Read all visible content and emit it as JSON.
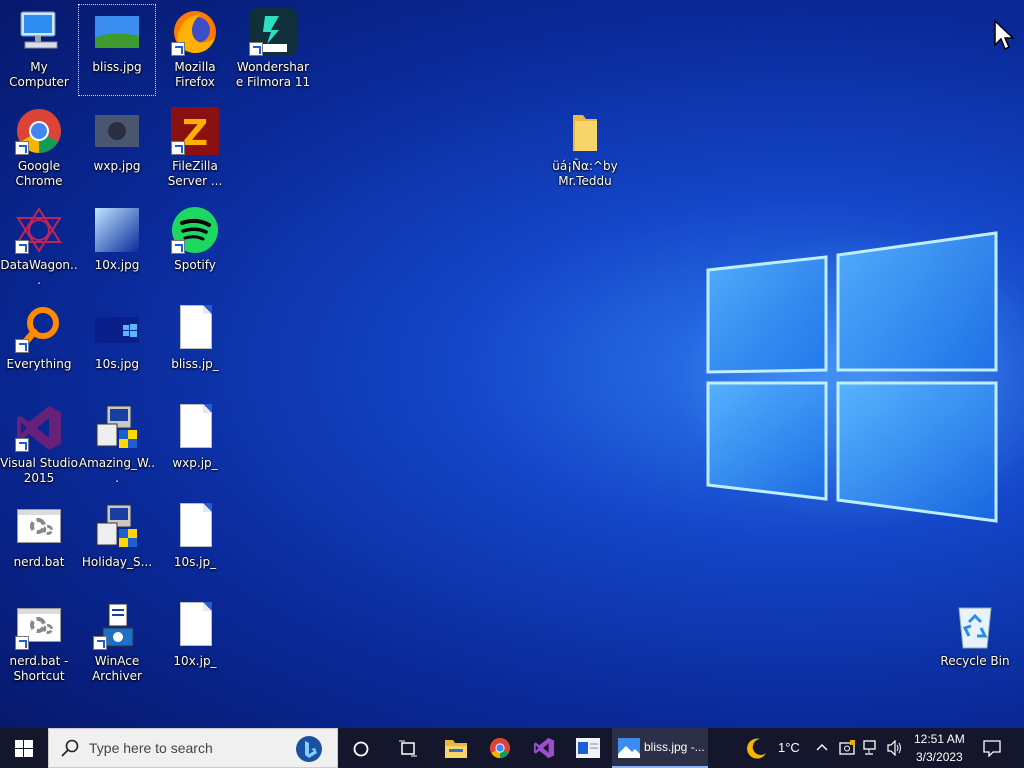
{
  "desktop": {
    "icons": [
      {
        "name": "my-computer",
        "label": "My Computer"
      },
      {
        "name": "bliss-jpg",
        "label": "bliss.jpg"
      },
      {
        "name": "mozilla-firefox",
        "label": "Mozilla Firefox"
      },
      {
        "name": "wondershare-filmora",
        "label": "Wondershare Filmora 11"
      },
      {
        "name": "google-chrome",
        "label": "Google Chrome"
      },
      {
        "name": "wxp-jpg",
        "label": "wxp.jpg"
      },
      {
        "name": "filezilla-server",
        "label": "FileZilla Server ..."
      },
      {
        "name": "folder-mr-teddu",
        "label": "üá¡Ñα:^by Mr.Teddu"
      },
      {
        "name": "datawagon",
        "label": "DataWagon..."
      },
      {
        "name": "10x-jpg",
        "label": "10x.jpg"
      },
      {
        "name": "spotify",
        "label": "Spotify"
      },
      {
        "name": "everything",
        "label": "Everything"
      },
      {
        "name": "10s-jpg",
        "label": "10s.jpg"
      },
      {
        "name": "bliss-jp_",
        "label": "bliss.jp_"
      },
      {
        "name": "visual-studio-2015",
        "label": "Visual Studio 2015"
      },
      {
        "name": "amazing-w",
        "label": "Amazing_W..."
      },
      {
        "name": "wxp-jp_",
        "label": "wxp.jp_"
      },
      {
        "name": "nerd-bat",
        "label": "nerd.bat"
      },
      {
        "name": "holiday-s",
        "label": "Holiday_S..."
      },
      {
        "name": "10s-jp_",
        "label": "10s.jp_"
      },
      {
        "name": "nerd-bat-shortcut",
        "label": "nerd.bat - Shortcut"
      },
      {
        "name": "winace-archiver",
        "label": "WinAce Archiver"
      },
      {
        "name": "10x-jp_",
        "label": "10x.jp_"
      },
      {
        "name": "recycle-bin",
        "label": "Recycle Bin"
      }
    ]
  },
  "taskbar": {
    "search_placeholder": "Type here to search",
    "active_window_label": "bliss.jpg -...",
    "weather_temp": "1°C",
    "time": "12:51 AM",
    "date": "3/3/2023"
  },
  "colors": {
    "taskbar_bg": "#14172b",
    "accent": "#8ab4f8",
    "desktop_blue": "#1446c8"
  }
}
